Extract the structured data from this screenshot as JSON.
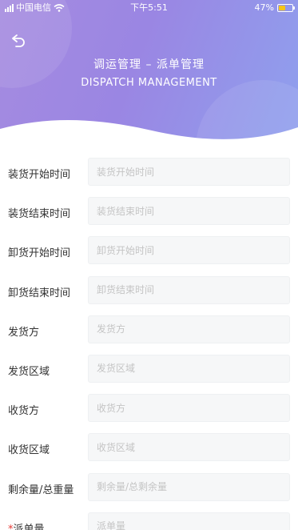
{
  "status_bar": {
    "carrier": "中国电信",
    "time": "下午5:51",
    "battery_percent": "47%",
    "battery_level": 0.47
  },
  "header": {
    "title_cn": "调运管理 – 派单管理",
    "title_en": "DISPATCH MANAGEMENT",
    "gradient_start": "#a58be0",
    "gradient_end": "#8fa0ee",
    "back_icon": "back-arrow-icon"
  },
  "form": {
    "required_mark": "*",
    "fields": [
      {
        "label": "装货开始时间",
        "placeholder": "装货开始时间"
      },
      {
        "label": "装货结束时间",
        "placeholder": "装货结束时间"
      },
      {
        "label": "卸货开始时间",
        "placeholder": "卸货开始时间"
      },
      {
        "label": "卸货结束时间",
        "placeholder": "卸货结束时间"
      },
      {
        "label": "发货方",
        "placeholder": "发货方"
      },
      {
        "label": "发货区域",
        "placeholder": "发货区域"
      },
      {
        "label": "收货方",
        "placeholder": "收货方"
      },
      {
        "label": "收货区域",
        "placeholder": "收货区域"
      },
      {
        "label": "剩余量/总重量",
        "placeholder": "剩余量/总剩余量"
      },
      {
        "label": "派单量",
        "placeholder": "派单量",
        "required": true
      }
    ]
  }
}
